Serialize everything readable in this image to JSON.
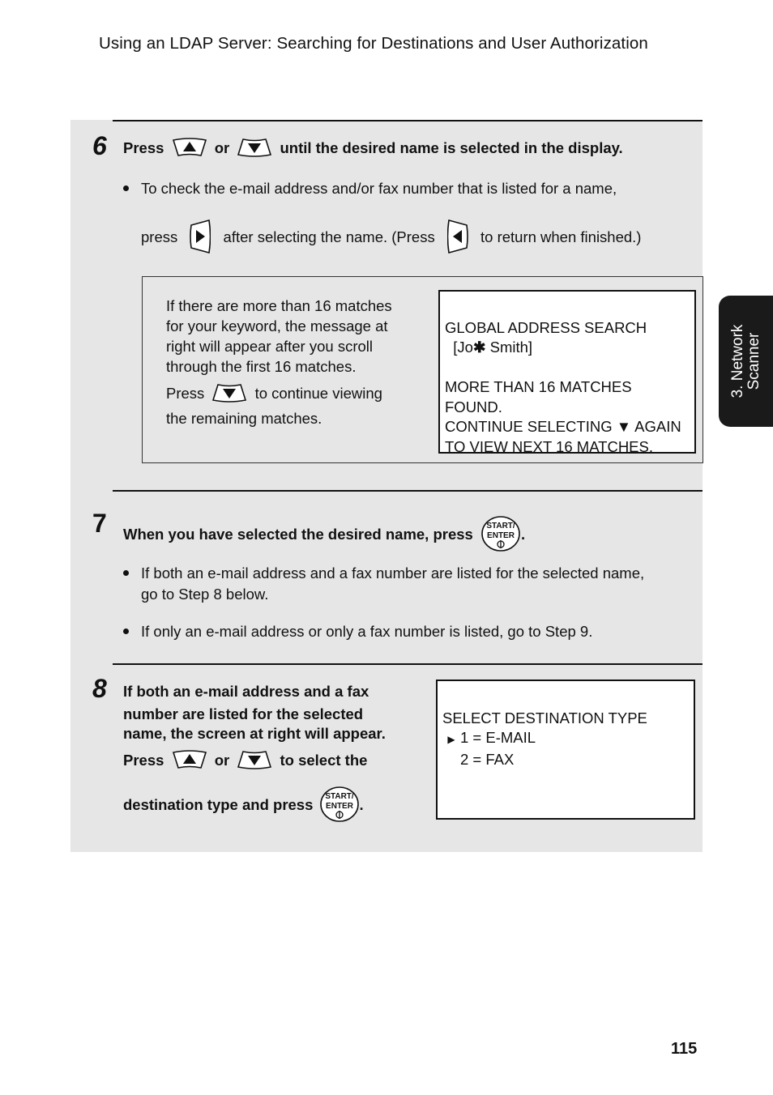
{
  "header": {
    "title": "Using an LDAP Server: Searching for Destinations and User Authorization"
  },
  "side_tab": {
    "line1": "3. Network",
    "line2": "Scanner"
  },
  "page_number": "115",
  "step6": {
    "number": "6",
    "instruction": {
      "press": "Press",
      "or": "or",
      "rest": "until the desired name is selected in the display."
    },
    "bullet": {
      "line1": "To check the e-mail address and/or fax number that is listed for a name,",
      "press": "press",
      "middle": "after selecting the name. (Press",
      "end": "to return when finished.)"
    },
    "note": {
      "lines": [
        "If there are more than 16 matches",
        "for your keyword, the message at",
        "right will appear after you scroll",
        "through the first 16 matches."
      ],
      "press": "Press",
      "continue": "to continue viewing",
      "remaining": "the remaining matches."
    },
    "lcd": {
      "line1": "GLOBAL ADDRESS SEARCH",
      "line2_prefix": "  [Jo",
      "line2_wildcard": "✱",
      "line2_suffix": " Smith]",
      "line3": "MORE THAN 16 MATCHES",
      "line4": "FOUND.",
      "line5_prefix": "CONTINUE SELECTING ",
      "line5_arrow": "▼",
      "line5_suffix": " AGAIN",
      "line6": "TO VIEW NEXT 16 MATCHES."
    }
  },
  "step7": {
    "number": "7",
    "instruction": "When you have selected the desired name, press",
    "period": ".",
    "bullets": [
      {
        "line1": "If both an e-mail address and a fax number are listed for the selected name,",
        "line2": "go to Step 8 below."
      },
      {
        "line1": "If only an e-mail address or only a fax number is listed, go to Step 9."
      }
    ]
  },
  "step8": {
    "number": "8",
    "lines": [
      "If both an e-mail address and a fax",
      "number are listed for the selected",
      "name, the screen at right will appear."
    ],
    "press": "Press",
    "or": "or",
    "to_select": "to select the",
    "dest": "destination type and press",
    "period": ".",
    "lcd": {
      "title": "SELECT DESTINATION TYPE",
      "cursor": "▶",
      "options": [
        "1 = E-MAIL",
        "2 = FAX"
      ]
    }
  },
  "keys": {
    "up": "up-arrow-key",
    "down": "down-arrow-key",
    "right": "right-arrow-key",
    "left": "left-arrow-key",
    "start_enter": {
      "line1": "START/",
      "line2": "ENTER"
    }
  }
}
